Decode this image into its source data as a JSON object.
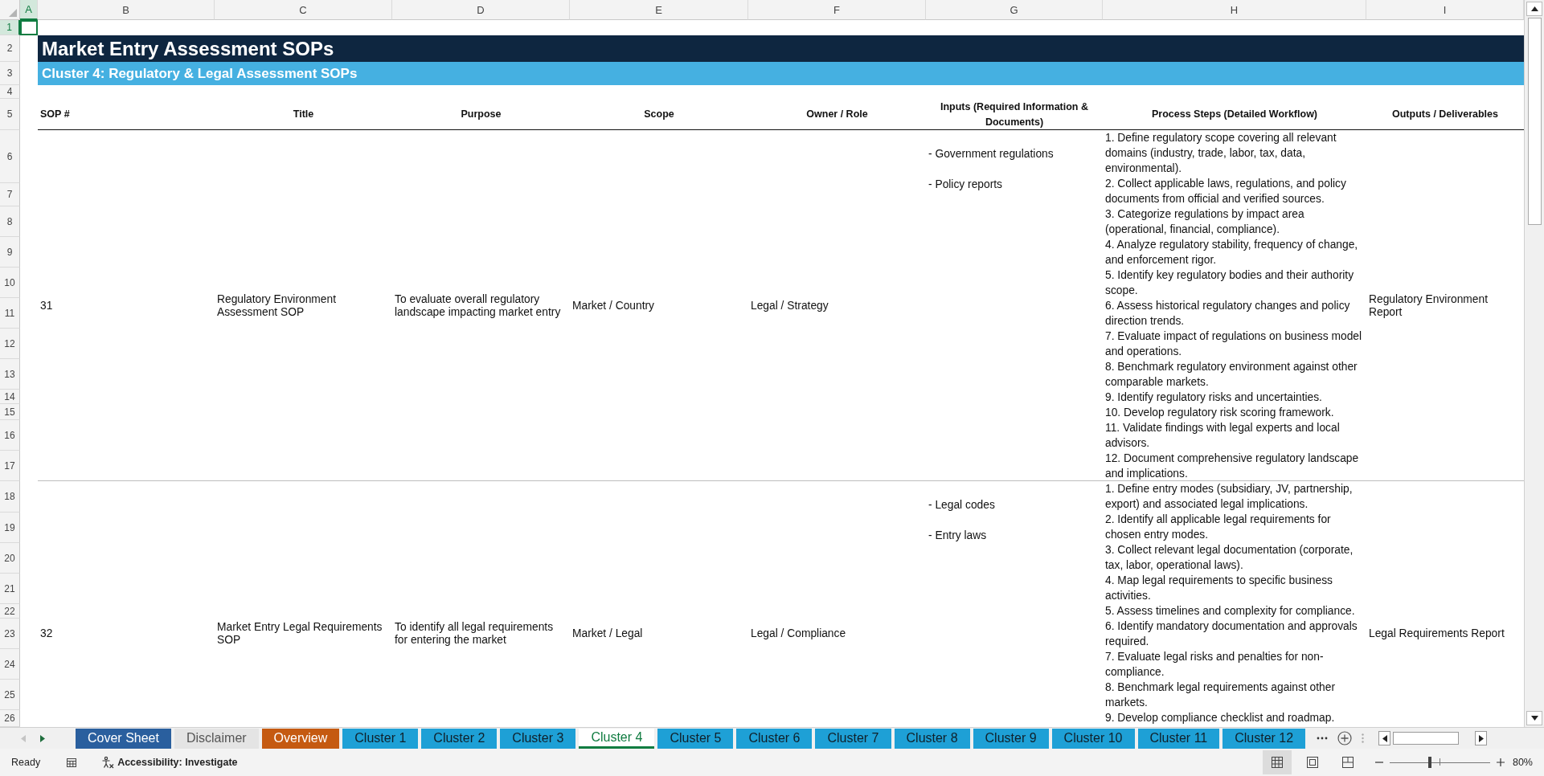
{
  "column_headers": [
    {
      "label": "A",
      "selected": true
    },
    {
      "label": "B",
      "selected": false
    },
    {
      "label": "C",
      "selected": false
    },
    {
      "label": "D",
      "selected": false
    },
    {
      "label": "E",
      "selected": false
    },
    {
      "label": "F",
      "selected": false
    },
    {
      "label": "G",
      "selected": false
    },
    {
      "label": "H",
      "selected": false
    },
    {
      "label": "I",
      "selected": false
    }
  ],
  "row_headers": [
    {
      "label": "1",
      "selected": true
    },
    {
      "label": "2",
      "selected": false
    },
    {
      "label": "3",
      "selected": false
    },
    {
      "label": "4",
      "selected": false
    },
    {
      "label": "5",
      "selected": false
    },
    {
      "label": "6",
      "selected": false
    },
    {
      "label": "7",
      "selected": false
    },
    {
      "label": "8",
      "selected": false
    },
    {
      "label": "9",
      "selected": false
    },
    {
      "label": "10",
      "selected": false
    },
    {
      "label": "11",
      "selected": false
    },
    {
      "label": "12",
      "selected": false
    },
    {
      "label": "13",
      "selected": false
    },
    {
      "label": "14",
      "selected": false
    },
    {
      "label": "15",
      "selected": false
    },
    {
      "label": "16",
      "selected": false
    },
    {
      "label": "17",
      "selected": false
    },
    {
      "label": "18",
      "selected": false
    },
    {
      "label": "19",
      "selected": false
    },
    {
      "label": "20",
      "selected": false
    },
    {
      "label": "21",
      "selected": false
    },
    {
      "label": "22",
      "selected": false
    },
    {
      "label": "23",
      "selected": false
    },
    {
      "label": "24",
      "selected": false
    },
    {
      "label": "25",
      "selected": false
    },
    {
      "label": "26",
      "selected": false
    }
  ],
  "sheet": {
    "title": "Market Entry Assessment SOPs",
    "subtitle": "Cluster 4: Regulatory & Legal Assessment SOPs",
    "columns": [
      "SOP #",
      "Title",
      "Purpose",
      "Scope",
      "Owner / Role",
      "Inputs (Required Information & Documents)",
      "Process Steps (Detailed Workflow)",
      "Outputs / Deliverables"
    ],
    "rows": [
      {
        "sop": "31",
        "title": "Regulatory Environment Assessment SOP",
        "purpose": "To evaluate overall regulatory landscape impacting market entry",
        "scope": "Market / Country",
        "owner": "Legal / Strategy",
        "inputs": [
          "- Government regulations",
          "- Policy reports"
        ],
        "steps": [
          "1. Define regulatory scope covering all relevant domains (industry, trade, labor, tax, data, environmental).",
          "2. Collect applicable laws, regulations, and policy documents from official and verified sources.",
          "3. Categorize regulations by impact area (operational, financial, compliance).",
          "4. Analyze regulatory stability, frequency of change, and enforcement rigor.",
          "5. Identify key regulatory bodies and their authority scope.",
          "6. Assess historical regulatory changes and policy direction trends.",
          "7. Evaluate impact of regulations on business model and operations.",
          "8. Benchmark regulatory environment against other comparable markets.",
          "9. Identify regulatory risks and uncertainties.",
          "10. Develop regulatory risk scoring framework.",
          "11. Validate findings with legal experts and local advisors.",
          "12. Document comprehensive regulatory landscape and implications."
        ],
        "outputs": "Regulatory Environment Report"
      },
      {
        "sop": "32",
        "title": "Market Entry Legal Requirements SOP",
        "purpose": "To identify all legal requirements for entering the market",
        "scope": "Market / Legal",
        "owner": "Legal / Compliance",
        "inputs": [
          "- Legal codes",
          "- Entry laws"
        ],
        "steps": [
          "1. Define entry modes (subsidiary, JV, partnership, export) and associated legal implications.",
          "2. Identify all applicable legal requirements for chosen entry modes.",
          "3. Collect relevant legal documentation (corporate, tax, labor, operational laws).",
          "4. Map legal requirements to specific business activities.",
          "5. Assess timelines and complexity for compliance.",
          "6. Identify mandatory documentation and approvals required.",
          "7. Evaluate legal risks and penalties for non-compliance.",
          "8. Benchmark legal requirements against other markets.",
          "9. Develop compliance checklist and roadmap."
        ],
        "outputs": "Legal Requirements Report"
      }
    ]
  },
  "sheet_tabs": [
    {
      "label": "Cover Sheet",
      "color": "#2a5f9e",
      "selected": false
    },
    {
      "label": "Disclaimer",
      "color": "#e4e4e4",
      "selected": false
    },
    {
      "label": "Overview",
      "color": "#c55a11",
      "selected": false
    },
    {
      "label": "Cluster 1",
      "color": "#1ea0d6",
      "selected": false
    },
    {
      "label": "Cluster 2",
      "color": "#1ea0d6",
      "selected": false
    },
    {
      "label": "Cluster 3",
      "color": "#1ea0d6",
      "selected": false
    },
    {
      "label": "Cluster 4",
      "selected": true
    },
    {
      "label": "Cluster 5",
      "color": "#1ea0d6",
      "selected": false
    },
    {
      "label": "Cluster 6",
      "color": "#1ea0d6",
      "selected": false
    },
    {
      "label": "Cluster 7",
      "color": "#1ea0d6",
      "selected": false
    },
    {
      "label": "Cluster 8",
      "color": "#1ea0d6",
      "selected": false
    },
    {
      "label": "Cluster 9",
      "color": "#1ea0d6",
      "selected": false
    },
    {
      "label": "Cluster 10",
      "color": "#1ea0d6",
      "selected": false
    },
    {
      "label": "Cluster 11",
      "color": "#1ea0d6",
      "selected": false
    },
    {
      "label": "Cluster 12",
      "color": "#1ea0d6",
      "selected": false
    }
  ],
  "status_bar": {
    "mode": "Ready",
    "accessibility": "Accessibility: Investigate",
    "view_buttons": [
      {
        "kind": "normal",
        "selected": true
      },
      {
        "kind": "page-layout",
        "selected": false
      },
      {
        "kind": "page-break",
        "selected": false
      }
    ],
    "zoom": {
      "level": 0.4,
      "reading": "80%"
    }
  }
}
